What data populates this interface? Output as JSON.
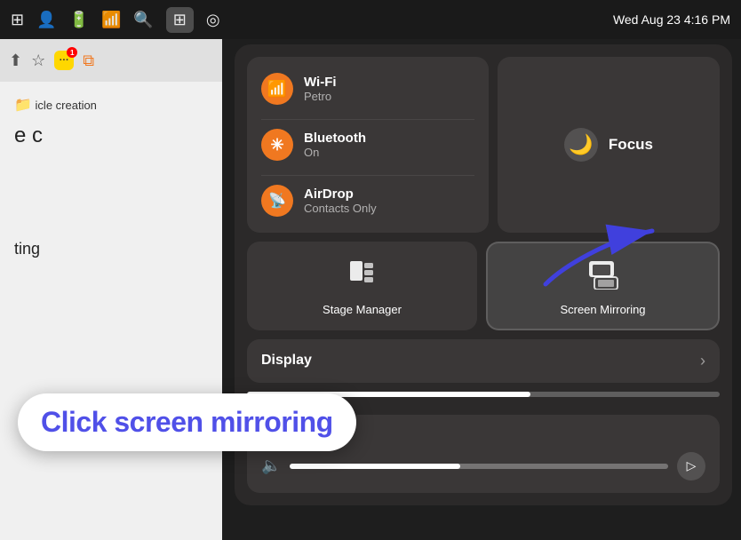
{
  "menubar": {
    "datetime": "Wed Aug 23  4:16 PM",
    "icons": [
      "grid-icon",
      "person-icon",
      "battery-icon",
      "wifi-icon",
      "search-icon",
      "control-center-icon",
      "siri-icon"
    ]
  },
  "article": {
    "title": "icle creation",
    "body_start": "e c",
    "body_bottom": "ting"
  },
  "control_center": {
    "wifi": {
      "name": "Wi-Fi",
      "network": "Petro"
    },
    "bluetooth": {
      "name": "Bluetooth",
      "status": "On"
    },
    "airdrop": {
      "name": "AirDrop",
      "status": "Contacts Only"
    },
    "focus": {
      "label": "Focus"
    },
    "stage_manager": {
      "label": "Stage\nManager"
    },
    "screen_mirroring": {
      "label": "Screen\nMirroring"
    },
    "display": {
      "label": "Display"
    },
    "sound": {
      "label": "Sound"
    }
  },
  "annotation": {
    "click_label": "Click screen mirroring"
  },
  "colors": {
    "orange": "#f07820",
    "purple": "#5050e8",
    "white": "#ffffff"
  }
}
